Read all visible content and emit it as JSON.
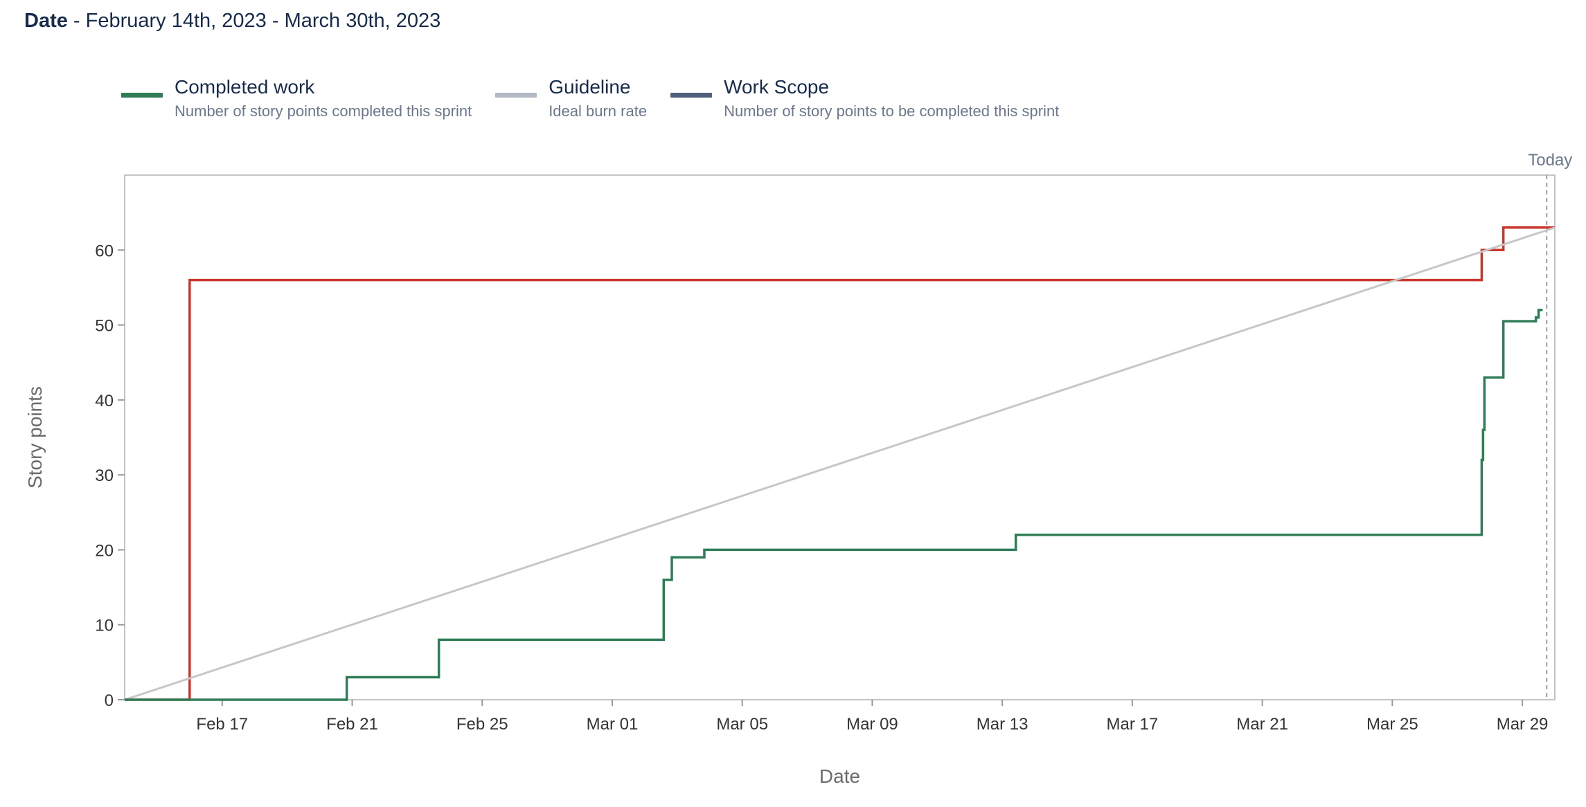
{
  "header": {
    "label": "Date",
    "range": " - February 14th, 2023 - March 30th, 2023"
  },
  "legend": [
    {
      "name": "Completed work",
      "description": "Number of story points completed this sprint",
      "color": "#2e7d57"
    },
    {
      "name": "Guideline",
      "description": "Ideal burn rate",
      "color": "#b3b9c4"
    },
    {
      "name": "Work Scope",
      "description": "Number of story points to be completed this sprint",
      "color": "#505f79"
    }
  ],
  "chart_data": {
    "type": "line",
    "xlabel": "Date",
    "ylabel": "Story points",
    "x_range": [
      "2023-02-14",
      "2023-03-30"
    ],
    "ylim": [
      0,
      70
    ],
    "y_ticks": [
      0,
      10,
      20,
      30,
      40,
      50,
      60
    ],
    "x_ticks": [
      {
        "date": "2023-02-17",
        "label": "Feb 17"
      },
      {
        "date": "2023-02-21",
        "label": "Feb 21"
      },
      {
        "date": "2023-02-25",
        "label": "Feb 25"
      },
      {
        "date": "2023-03-01",
        "label": "Mar 01"
      },
      {
        "date": "2023-03-05",
        "label": "Mar 05"
      },
      {
        "date": "2023-03-09",
        "label": "Mar 09"
      },
      {
        "date": "2023-03-13",
        "label": "Mar 13"
      },
      {
        "date": "2023-03-17",
        "label": "Mar 17"
      },
      {
        "date": "2023-03-21",
        "label": "Mar 21"
      },
      {
        "date": "2023-03-25",
        "label": "Mar 25"
      },
      {
        "date": "2023-03-29",
        "label": "Mar 29"
      }
    ],
    "today": {
      "date": "2023-03-29T18:00",
      "label": "Today"
    },
    "series": [
      {
        "name": "Scope",
        "color": "#c9372c",
        "step": true,
        "points": [
          [
            "2023-02-14T00:00",
            0
          ],
          [
            "2023-02-16T00:00",
            56
          ],
          [
            "2023-03-27T18:00",
            60
          ],
          [
            "2023-03-28T10:00",
            63
          ],
          [
            "2023-03-30T00:00",
            63
          ]
        ]
      },
      {
        "name": "Guideline",
        "color": "#c7c7c7",
        "step": false,
        "points": [
          [
            "2023-02-14T00:00",
            0
          ],
          [
            "2023-03-30T00:00",
            63
          ]
        ]
      },
      {
        "name": "Completed work",
        "color": "#2e7d57",
        "step": true,
        "points": [
          [
            "2023-02-14T00:00",
            0
          ],
          [
            "2023-02-20T20:00",
            3
          ],
          [
            "2023-02-23T16:00",
            8
          ],
          [
            "2023-03-02T14:00",
            16
          ],
          [
            "2023-03-02T20:00",
            19
          ],
          [
            "2023-03-03T20:00",
            20
          ],
          [
            "2023-03-13T10:00",
            22
          ],
          [
            "2023-03-27T18:00",
            32
          ],
          [
            "2023-03-27T19:00",
            36
          ],
          [
            "2023-03-27T20:00",
            43
          ],
          [
            "2023-03-28T10:00",
            50.5
          ],
          [
            "2023-03-29T10:00",
            51
          ],
          [
            "2023-03-29T12:00",
            52
          ],
          [
            "2023-03-29T15:00",
            52
          ]
        ]
      }
    ]
  }
}
